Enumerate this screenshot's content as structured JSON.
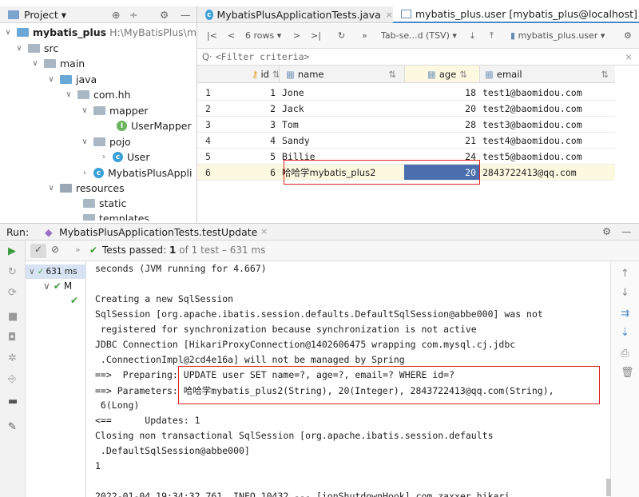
{
  "project_panel": {
    "title": "Project ▾",
    "tree": [
      {
        "label": "mybatis_plus",
        "suffix": "H:\\MyBatisPlus\\myb"
      },
      {
        "label": "src"
      },
      {
        "label": "main"
      },
      {
        "label": "java"
      },
      {
        "label": "com.hh"
      },
      {
        "label": "mapper"
      },
      {
        "label": "UserMapper"
      },
      {
        "label": "pojo"
      },
      {
        "label": "User"
      },
      {
        "label": "MybatisPlusAppli"
      },
      {
        "label": "resources"
      },
      {
        "label": "static"
      },
      {
        "label": "templates"
      }
    ]
  },
  "tabs": [
    {
      "label": "MybatisPlusApplicationTests.java"
    },
    {
      "label": "mybatis_plus.user [mybatis_plus@localhost]"
    }
  ],
  "toolbar": {
    "rows": "6 rows ▾",
    "format": "Tab-se...d (TSV) ▾",
    "table": "mybatis_plus.user ▾"
  },
  "filter": {
    "placeholder": "<Filter criteria>"
  },
  "grid": {
    "columns": [
      "id",
      "name",
      "age",
      "email"
    ],
    "rows": [
      {
        "n": "1",
        "id": "1",
        "name": "Jone",
        "age": "18",
        "email": "test1@baomidou.com"
      },
      {
        "n": "2",
        "id": "2",
        "name": "Jack",
        "age": "20",
        "email": "test2@baomidou.com"
      },
      {
        "n": "3",
        "id": "3",
        "name": "Tom",
        "age": "28",
        "email": "test3@baomidou.com"
      },
      {
        "n": "4",
        "id": "4",
        "name": "Sandy",
        "age": "21",
        "email": "test4@baomidou.com"
      },
      {
        "n": "5",
        "id": "5",
        "name": "Billie",
        "age": "24",
        "email": "test5@baomidou.com"
      },
      {
        "n": "6",
        "id": "6",
        "name": "哈哈学mybatis_plus2",
        "age": "20",
        "email": "2843722413@qq.com"
      }
    ]
  },
  "run": {
    "label": "Run:",
    "config": "MybatisPlusApplicationTests.testUpdate",
    "status_passed": "Tests passed:",
    "status_count": "1",
    "status_rest": "of 1 test – 631 ms",
    "tree_time": "631 ms",
    "tree_child": "M"
  },
  "console": [
    "seconds (JVM running for 4.667)",
    "",
    "Creating a new SqlSession",
    "SqlSession [org.apache.ibatis.session.defaults.DefaultSqlSession@abbe000] was not",
    " registered for synchronization because synchronization is not active",
    "JDBC Connection [HikariProxyConnection@1402606475 wrapping com.mysql.cj.jdbc",
    " .ConnectionImpl@2cd4e16a] will not be managed by Spring",
    "==>  Preparing: UPDATE user SET name=?, age=?, email=? WHERE id=?",
    "==> Parameters: 哈哈学mybatis_plus2(String), 20(Integer), 2843722413@qq.com(String),",
    " 6(Long)",
    "<==      Updates: 1",
    "Closing non transactional SqlSession [org.apache.ibatis.session.defaults",
    " .DefaultSqlSession@abbe000]",
    "1",
    "",
    "2022-01-04 19:34:32.761  INFO 10432 --- [ionShutdownHook] com.zaxxer.hikari"
  ],
  "colors": {
    "accent": "#4a86c8",
    "selected_cell": "#4b6eaf",
    "row_highlight": "#fdf9e0",
    "highlight_box": "#e02020"
  }
}
